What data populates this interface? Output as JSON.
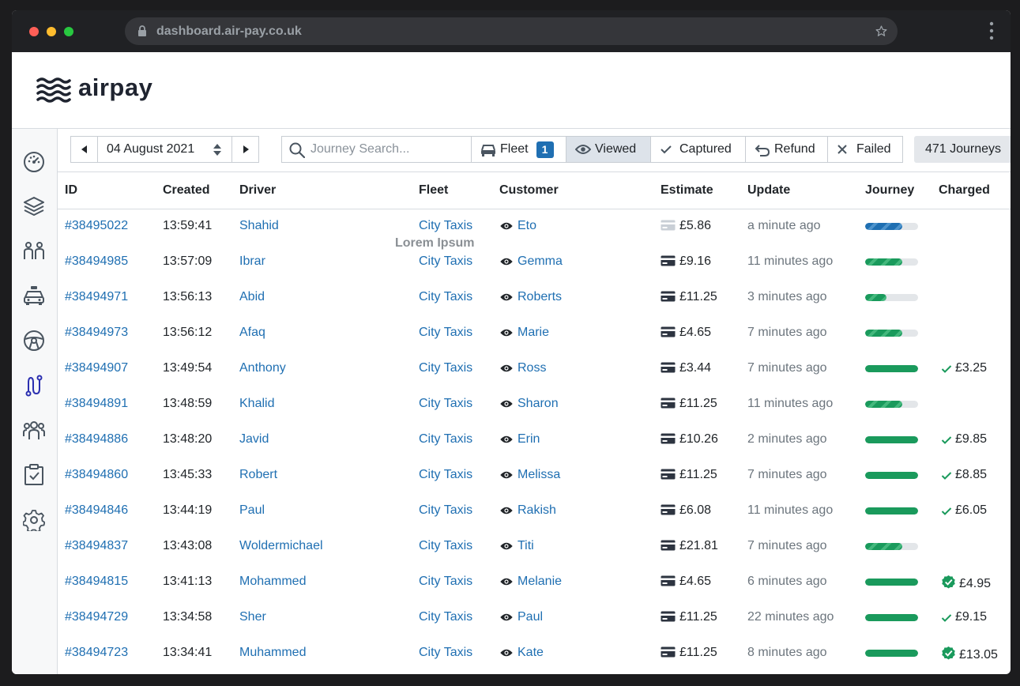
{
  "browser": {
    "url": "dashboard.air-pay.co.uk"
  },
  "brand": {
    "name": "airpay"
  },
  "colors": {
    "accent": "#1f6fb2",
    "success": "#1a9a5c",
    "muted": "#6c757d"
  },
  "sidebar": {
    "items": [
      {
        "icon": "dashboard-gauge-icon"
      },
      {
        "icon": "layers-icon"
      },
      {
        "icon": "drivers-icon"
      },
      {
        "icon": "taxi-icon"
      },
      {
        "icon": "steering-wheel-icon"
      },
      {
        "icon": "journeys-route-icon",
        "active": true
      },
      {
        "icon": "team-icon"
      },
      {
        "icon": "clipboard-check-icon"
      },
      {
        "icon": "settings-gear-icon"
      }
    ]
  },
  "toolbar": {
    "date": "04 August 2021",
    "search_placeholder": "Journey Search...",
    "filters": {
      "fleet": {
        "label": "Fleet",
        "count": "1"
      },
      "viewed": {
        "label": "Viewed"
      },
      "captured": {
        "label": "Captured"
      },
      "refund": {
        "label": "Refund"
      },
      "failed": {
        "label": "Failed"
      }
    },
    "journey_count": "471 Journeys"
  },
  "table": {
    "headers": {
      "id": "ID",
      "created": "Created",
      "driver": "Driver",
      "fleet": "Fleet",
      "customer": "Customer",
      "estimate": "Estimate",
      "update": "Update",
      "journey": "Journey",
      "charged": "Charged"
    },
    "rows": [
      {
        "id": "#38495022",
        "created": "13:59:41",
        "driver": "Shahid",
        "fleet": "City Taxis",
        "customer": "Eto",
        "estimate": "£5.86",
        "update": "a minute ago",
        "progress": 0.7,
        "progress_style": "blue",
        "charged": "",
        "charged_state": ""
      },
      {
        "id": "#38494985",
        "created": "13:57:09",
        "driver": "Ibrar",
        "fleet": "City Taxis",
        "customer": "Gemma",
        "estimate": "£9.16",
        "update": "11 minutes ago",
        "progress": 0.7,
        "progress_style": "green",
        "charged": "",
        "charged_state": ""
      },
      {
        "id": "#38494971",
        "created": "13:56:13",
        "driver": "Abid",
        "fleet": "City Taxis",
        "customer": "Roberts",
        "estimate": "£11.25",
        "update": "3 minutes ago",
        "progress": 0.4,
        "progress_style": "green",
        "charged": "",
        "charged_state": ""
      },
      {
        "id": "#38494973",
        "created": "13:56:12",
        "driver": "Afaq",
        "fleet": "City Taxis",
        "customer": "Marie",
        "estimate": "£4.65",
        "update": "7 minutes ago",
        "progress": 0.7,
        "progress_style": "green",
        "charged": "",
        "charged_state": ""
      },
      {
        "id": "#38494907",
        "created": "13:49:54",
        "driver": "Anthony",
        "fleet": "City Taxis",
        "customer": "Ross",
        "estimate": "£3.44",
        "update": "7 minutes ago",
        "progress": 1.0,
        "progress_style": "full",
        "charged": "£3.25",
        "charged_state": "check"
      },
      {
        "id": "#38494891",
        "created": "13:48:59",
        "driver": "Khalid",
        "fleet": "City Taxis",
        "customer": "Sharon",
        "estimate": "£11.25",
        "update": "11 minutes ago",
        "progress": 0.7,
        "progress_style": "green",
        "charged": "",
        "charged_state": ""
      },
      {
        "id": "#38494886",
        "created": "13:48:20",
        "driver": "Javid",
        "fleet": "City Taxis",
        "customer": "Erin",
        "estimate": "£10.26",
        "update": "2 minutes ago",
        "progress": 1.0,
        "progress_style": "full",
        "charged": "£9.85",
        "charged_state": "check"
      },
      {
        "id": "#38494860",
        "created": "13:45:33",
        "driver": "Robert",
        "fleet": "City Taxis",
        "customer": "Melissa",
        "estimate": "£11.25",
        "update": "7 minutes ago",
        "progress": 1.0,
        "progress_style": "full",
        "charged": "£8.85",
        "charged_state": "check"
      },
      {
        "id": "#38494846",
        "created": "13:44:19",
        "driver": "Paul",
        "fleet": "City Taxis",
        "customer": "Rakish",
        "estimate": "£6.08",
        "update": "11 minutes ago",
        "progress": 1.0,
        "progress_style": "full",
        "charged": "£6.05",
        "charged_state": "check"
      },
      {
        "id": "#38494837",
        "created": "13:43:08",
        "driver": "Woldermichael",
        "fleet": "City Taxis",
        "customer": "Titi",
        "estimate": "£21.81",
        "update": "7 minutes ago",
        "progress": 0.7,
        "progress_style": "green",
        "charged": "",
        "charged_state": ""
      },
      {
        "id": "#38494815",
        "created": "13:41:13",
        "driver": "Mohammed",
        "fleet": "City Taxis",
        "customer": "Melanie",
        "estimate": "£4.65",
        "update": "6 minutes ago",
        "progress": 1.0,
        "progress_style": "full",
        "charged": "£4.95",
        "charged_state": "verified"
      },
      {
        "id": "#38494729",
        "created": "13:34:58",
        "driver": "Sher",
        "fleet": "City Taxis",
        "customer": "Paul",
        "estimate": "£11.25",
        "update": "22 minutes ago",
        "progress": 1.0,
        "progress_style": "full",
        "charged": "£9.15",
        "charged_state": "check"
      },
      {
        "id": "#38494723",
        "created": "13:34:41",
        "driver": "Muhammed",
        "fleet": "City Taxis",
        "customer": "Kate",
        "estimate": "£11.25",
        "update": "8 minutes ago",
        "progress": 1.0,
        "progress_style": "full",
        "charged": "£13.05",
        "charged_state": "verified"
      }
    ]
  },
  "tooltip": {
    "text": "Lorem Ipsum"
  }
}
